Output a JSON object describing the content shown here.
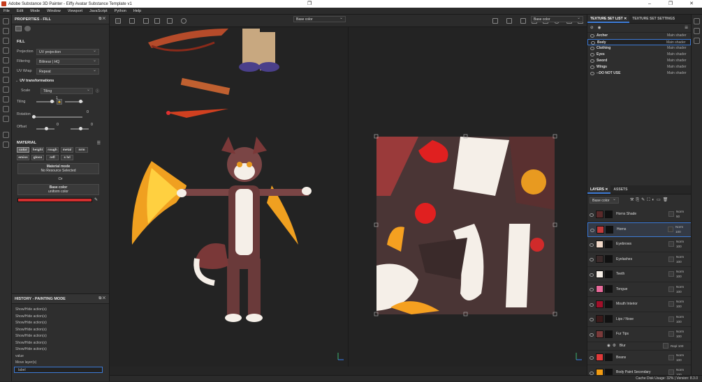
{
  "window": {
    "title": "Adobe Substance 3D Painter - Eiffy Avatar Substance Template v1",
    "icons": {
      "logo": "painter-logo-icon",
      "minimize": "minimize-icon",
      "maximize": "maximize-icon",
      "close": "close-icon"
    },
    "center_icon": "restore-small-icon"
  },
  "menu": [
    "File",
    "Edit",
    "Mode",
    "Window",
    "Viewport",
    "JavaScript",
    "Python",
    "Help"
  ],
  "properties": {
    "title": "PROPERTIES - FILL",
    "section_fill": "FILL",
    "projection_label": "Projection",
    "projection_value": "UV projection",
    "filtering_label": "Filtering",
    "filtering_value": "Bilinear | HQ",
    "uvwrap_label": "UV Wrap",
    "uvwrap_value": "Repeat",
    "uvtrans": "UV transformations",
    "scale_label": "Scale",
    "scale_value": "Tiling",
    "tiling_label": "Tiling",
    "tiling_val": "1",
    "rotation_label": "Rotation",
    "rotation_val": "0",
    "offset_label": "Offset",
    "offset_val1": "0",
    "offset_val2": "0",
    "material_title": "MATERIAL",
    "chips": [
      "color",
      "height",
      "rough",
      "metal",
      "nrm",
      "emiss",
      "gloss",
      "refl",
      "s lvl"
    ],
    "material_mode": "Material mode",
    "no_resource": "No Resource Selected",
    "or": "Or",
    "base_color": "Base color",
    "uniform_color": "uniform color",
    "swatch_color": "#d32f2f"
  },
  "history": {
    "title": "HISTORY - PAINTING MODE",
    "items": [
      "Show/Hide action(s)",
      "Show/Hide action(s)",
      "Show/Hide action(s)",
      "Show/Hide action(s)",
      "Show/Hide action(s)",
      "Show/Hide action(s)",
      "Show/Hide action(s)",
      "value",
      "Move layer(s)",
      "label"
    ]
  },
  "viewport": {
    "left_channel": "Base color",
    "right_channel": "Base color"
  },
  "texture_sets": {
    "tab1": "TEXTURE SET LIST",
    "tab2": "TEXTURE SET SETTINGS",
    "rows": [
      {
        "name": "Archer",
        "shader": "Main shader"
      },
      {
        "name": "Body",
        "shader": "Main shader"
      },
      {
        "name": "Clothing",
        "shader": "Main shader"
      },
      {
        "name": "Eyes",
        "shader": "Main shader"
      },
      {
        "name": "Sword",
        "shader": "Main shader"
      },
      {
        "name": "Wings",
        "shader": "Main shader"
      },
      {
        "name": "--DO NOT USE",
        "shader": "Main shader"
      }
    ]
  },
  "layers_panel": {
    "tab1": "LAYERS",
    "tab2": "ASSETS",
    "channel": "Base color",
    "layers": [
      {
        "name": "Horns Shade",
        "blend": "Norm",
        "opacity": "50",
        "color": "#5a2a2a"
      },
      {
        "name": "Horns",
        "blend": "Norm",
        "opacity": "100",
        "color": "#c23a3a"
      },
      {
        "name": "Eyebrows",
        "blend": "Norm",
        "opacity": "100",
        "color": "#f0d8c8"
      },
      {
        "name": "Eyelashes",
        "blend": "Norm",
        "opacity": "100",
        "color": "#3a2a2a"
      },
      {
        "name": "Teeth",
        "blend": "Norm",
        "opacity": "100",
        "color": "#f5eee6"
      },
      {
        "name": "Tongue",
        "blend": "Norm",
        "opacity": "100",
        "color": "#e86a9a"
      },
      {
        "name": "Mouth Interior",
        "blend": "Norm",
        "opacity": "100",
        "color": "#a0102a"
      },
      {
        "name": "Lips / Nose",
        "blend": "Norm",
        "opacity": "100",
        "color": "#3a1a1a"
      },
      {
        "name": "Fur Tips",
        "blend": "Norm",
        "opacity": "100",
        "color": "#7a3a3a"
      },
      {
        "name": "Blur",
        "blend": "Repl",
        "opacity": "100",
        "color": "#555555"
      },
      {
        "name": "Beans",
        "blend": "Norm",
        "opacity": "100",
        "color": "#e03a3a"
      },
      {
        "name": "Body Paint Secondary",
        "blend": "Norm",
        "opacity": "100",
        "color": "#f39c12"
      }
    ]
  },
  "status": "Cache Disk Usage:   32%  |  Version: 8.3.0"
}
